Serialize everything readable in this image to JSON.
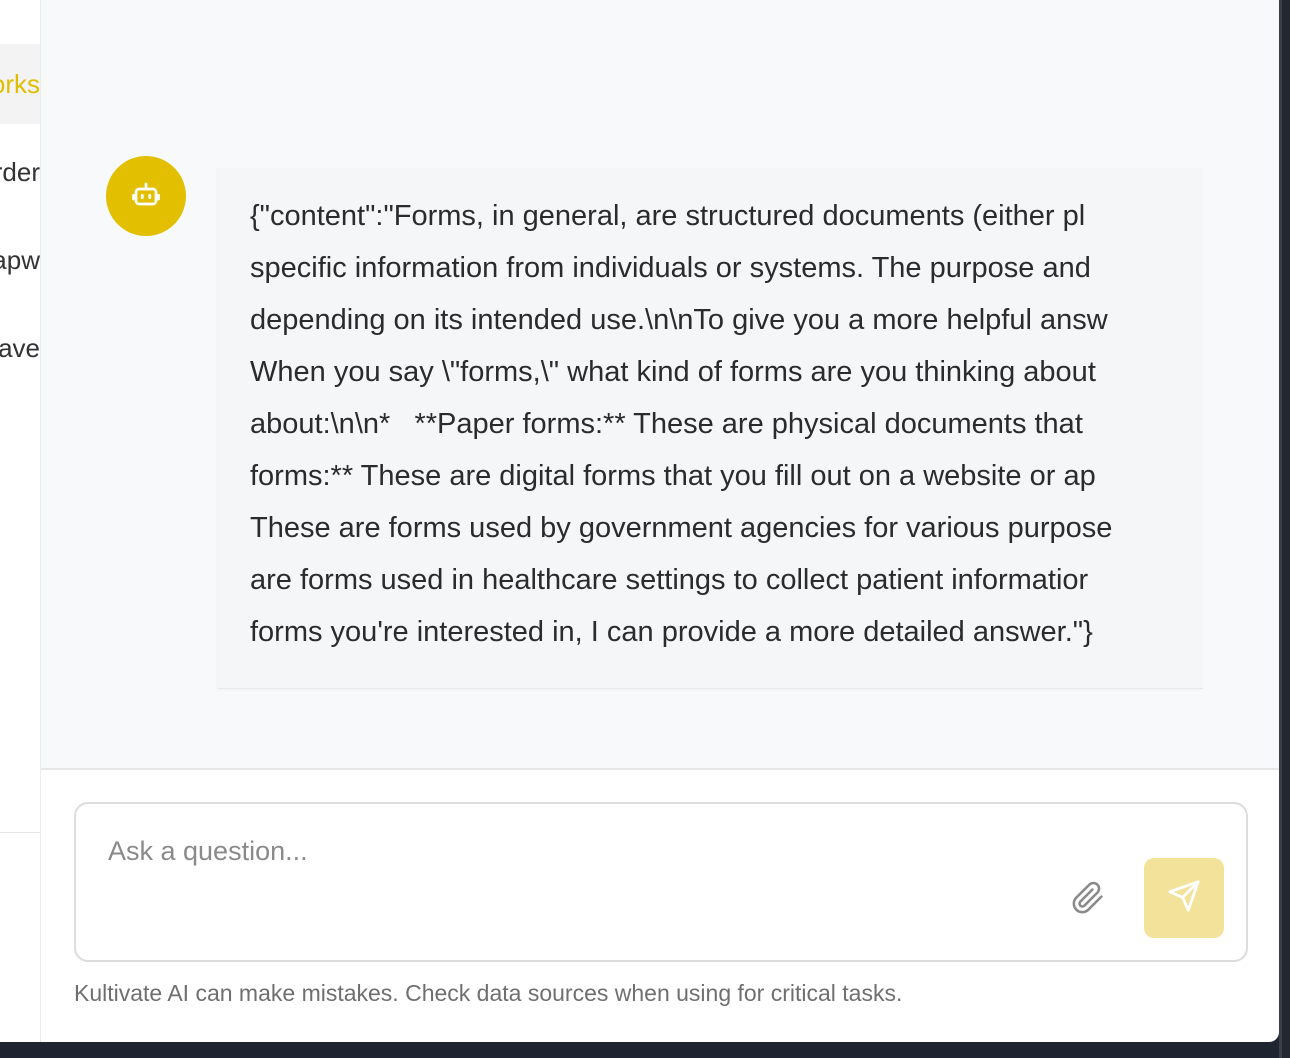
{
  "sidebar": {
    "items": [
      {
        "label": "orks",
        "active": true
      },
      {
        "label": "rder",
        "active": false
      },
      {
        "label": "apw",
        "active": false
      },
      {
        "label": "ave",
        "active": false
      }
    ]
  },
  "chat": {
    "assistant_icon": "robot-icon",
    "message_lines": [
      "{\"content\":\"Forms, in general, are structured documents (either pl",
      "specific information from individuals or systems. The purpose and",
      "depending on its intended use.\\n\\nTo give you a more helpful answ",
      "When you say \\\"forms,\\\" what kind of forms are you thinking about",
      "about:\\n\\n*   **Paper forms:** These are physical documents that",
      "forms:** These are digital forms that you fill out on a website or ap",
      "These are forms used by government agencies for various purpose",
      "are forms used in healthcare settings to collect patient informatior",
      "forms you're interested in, I can provide a more detailed answer.\"}"
    ]
  },
  "composer": {
    "placeholder": "Ask a question...",
    "attach_icon": "paperclip-icon",
    "send_icon": "send-icon"
  },
  "footer": {
    "disclaimer": "Kultivate AI can make mistakes. Check data sources when using for critical tasks."
  },
  "colors": {
    "accent": "#e2bf00",
    "send_button": "#f2e29a",
    "active_item_text": "#e0bd00"
  }
}
